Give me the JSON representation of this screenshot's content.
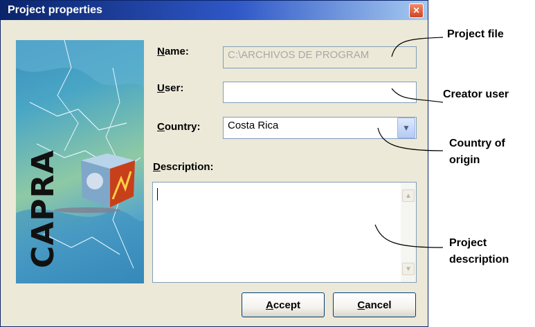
{
  "window": {
    "title": "Project properties",
    "close_label": "×"
  },
  "image": {
    "logo_text": "CAPRA"
  },
  "form": {
    "name": {
      "label_accel": "N",
      "label_rest": "ame:",
      "value": "C:\\ARCHIVOS DE PROGRAM"
    },
    "user": {
      "label_accel": "U",
      "label_rest": "ser:",
      "value": ""
    },
    "country": {
      "label_accel": "C",
      "label_rest": "ountry:",
      "value": "Costa Rica"
    },
    "description": {
      "label_accel": "D",
      "label_rest": "escription:",
      "value": ""
    }
  },
  "buttons": {
    "accept": {
      "accel": "A",
      "rest": "ccept"
    },
    "cancel": {
      "accel": "C",
      "rest": "ancel"
    }
  },
  "annotations": {
    "project_file": "Project file",
    "creator_user": "Creator user",
    "country_line1": "Country of",
    "country_line2": "origin",
    "desc_line1": "Project",
    "desc_line2": "description"
  }
}
